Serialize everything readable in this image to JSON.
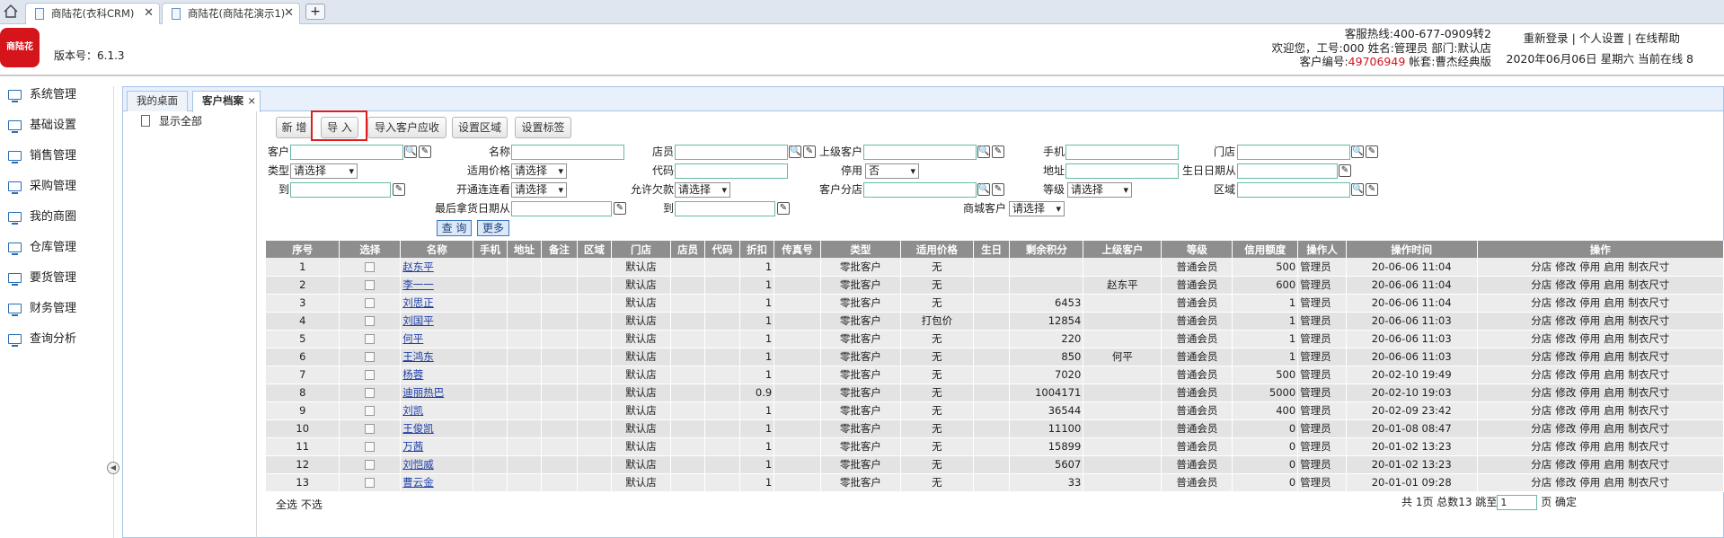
{
  "browser": {
    "tabs": [
      {
        "label": "商陆花(衣科CRM)"
      },
      {
        "label": "商陆花(商陆花演示1)"
      }
    ],
    "new_tab": "+"
  },
  "header": {
    "logo_text": "商陆花",
    "version": "版本号：6.1.3",
    "hotline": "客服热线:400-677-0909转2",
    "welcome": "欢迎您，工号:000 姓名:管理员 部门:默认店",
    "customer_no_label": "客户编号:",
    "customer_no": "49706949",
    "account": "帐套:曹杰经典版",
    "links": "重新登录 | 个人设置 | 在线帮助",
    "date_info": "2020年06月06日 星期六 当前在线 8"
  },
  "sidebar": {
    "items": [
      {
        "label": "系统管理"
      },
      {
        "label": "基础设置"
      },
      {
        "label": "销售管理"
      },
      {
        "label": "采购管理"
      },
      {
        "label": "我的商圈"
      },
      {
        "label": "仓库管理"
      },
      {
        "label": "要货管理"
      },
      {
        "label": "财务管理"
      },
      {
        "label": "查询分析"
      }
    ]
  },
  "main_tabs": [
    {
      "label": "我的桌面"
    },
    {
      "label": "客户档案"
    }
  ],
  "tree": {
    "show_all": "显示全部"
  },
  "toolbar": {
    "new": "新 增",
    "import": "导 入",
    "import_receivable": "导入客户应收",
    "set_region": "设置区域",
    "set_tag": "设置标签"
  },
  "filters": {
    "customer": "客户",
    "name": "名称",
    "clerk": "店员",
    "parent_customer": "上级客户",
    "mobile": "手机",
    "store": "门店",
    "type": "类型",
    "type_value": "请选择",
    "price": "适用价格",
    "price_value": "请选择",
    "code": "代码",
    "disabled": "停用",
    "disabled_value": "否",
    "address": "地址",
    "birthday_from": "生日日期从",
    "to": "到",
    "open_view": "开通连连看",
    "open_view_value": "请选择",
    "allow_debt": "允许欠款",
    "allow_debt_value": "请选择",
    "branch": "客户分店",
    "level": "等级",
    "level_value": "请选择",
    "region": "区域",
    "last_pick_from": "最后拿货日期从",
    "mall_customer": "商城客户",
    "mall_value": "请选择",
    "query": "查 询",
    "more": "更多"
  },
  "table": {
    "columns": [
      "序号",
      "选择",
      "名称",
      "手机",
      "地址",
      "备注",
      "区域",
      "门店",
      "店员",
      "代码",
      "折扣",
      "传真号",
      "类型",
      "适用价格",
      "生日",
      "剩余积分",
      "上级客户",
      "等级",
      "信用额度",
      "操作人",
      "操作时间",
      "操作"
    ],
    "ops": [
      "分店",
      "修改",
      "停用",
      "启用",
      "制衣尺寸"
    ],
    "rows": [
      {
        "no": "1",
        "name": "赵东平",
        "store": "默认店",
        "discount": "1",
        "type": "零批客户",
        "price": "无",
        "points": "",
        "parent": "",
        "level": "普通会员",
        "credit": "500",
        "op": "管理员",
        "time": "20-06-06 11:04"
      },
      {
        "no": "2",
        "name": "李一一",
        "store": "默认店",
        "discount": "1",
        "type": "零批客户",
        "price": "无",
        "points": "",
        "parent": "赵东平",
        "level": "普通会员",
        "credit": "600",
        "op": "管理员",
        "time": "20-06-06 11:04"
      },
      {
        "no": "3",
        "name": "刘思正",
        "store": "默认店",
        "discount": "1",
        "type": "零批客户",
        "price": "无",
        "points": "6453",
        "parent": "",
        "level": "普通会员",
        "credit": "1",
        "op": "管理员",
        "time": "20-06-06 11:04"
      },
      {
        "no": "4",
        "name": "刘国平",
        "store": "默认店",
        "discount": "1",
        "type": "零批客户",
        "price": "打包价",
        "points": "12854",
        "parent": "",
        "level": "普通会员",
        "credit": "1",
        "op": "管理员",
        "time": "20-06-06 11:03"
      },
      {
        "no": "5",
        "name": "何平",
        "store": "默认店",
        "discount": "1",
        "type": "零批客户",
        "price": "无",
        "points": "220",
        "parent": "",
        "level": "普通会员",
        "credit": "1",
        "op": "管理员",
        "time": "20-06-06 11:03"
      },
      {
        "no": "6",
        "name": "王鸿东",
        "store": "默认店",
        "discount": "1",
        "type": "零批客户",
        "price": "无",
        "points": "850",
        "parent": "何平",
        "level": "普通会员",
        "credit": "1",
        "op": "管理员",
        "time": "20-06-06 11:03"
      },
      {
        "no": "7",
        "name": "杨蓉",
        "store": "默认店",
        "discount": "1",
        "type": "零批客户",
        "price": "无",
        "points": "7020",
        "parent": "",
        "level": "普通会员",
        "credit": "500",
        "op": "管理员",
        "time": "20-02-10 19:49"
      },
      {
        "no": "8",
        "name": "迪丽热巴",
        "store": "默认店",
        "discount": "0.9",
        "type": "零批客户",
        "price": "无",
        "points": "1004171",
        "parent": "",
        "level": "普通会员",
        "credit": "5000",
        "op": "管理员",
        "time": "20-02-10 19:03"
      },
      {
        "no": "9",
        "name": "刘凯",
        "store": "默认店",
        "discount": "1",
        "type": "零批客户",
        "price": "无",
        "points": "36544",
        "parent": "",
        "level": "普通会员",
        "credit": "400",
        "op": "管理员",
        "time": "20-02-09 23:42"
      },
      {
        "no": "10",
        "name": "王俊凯",
        "store": "默认店",
        "discount": "1",
        "type": "零批客户",
        "price": "无",
        "points": "11100",
        "parent": "",
        "level": "普通会员",
        "credit": "0",
        "op": "管理员",
        "time": "20-01-08 08:47"
      },
      {
        "no": "11",
        "name": "万茜",
        "store": "默认店",
        "discount": "1",
        "type": "零批客户",
        "price": "无",
        "points": "15899",
        "parent": "",
        "level": "普通会员",
        "credit": "0",
        "op": "管理员",
        "time": "20-01-02 13:23"
      },
      {
        "no": "12",
        "name": "刘恺威",
        "store": "默认店",
        "discount": "1",
        "type": "零批客户",
        "price": "无",
        "points": "5607",
        "parent": "",
        "level": "普通会员",
        "credit": "0",
        "op": "管理员",
        "time": "20-01-02 13:23"
      },
      {
        "no": "13",
        "name": "曹云金",
        "store": "默认店",
        "discount": "1",
        "type": "零批客户",
        "price": "无",
        "points": "33",
        "parent": "",
        "level": "普通会员",
        "credit": "0",
        "op": "管理员",
        "time": "20-01-01 09:28"
      }
    ]
  },
  "footer": {
    "select_all": "全选",
    "select_none": "不选",
    "page_info": "共 1页 总数13 跳至",
    "page_value": "1",
    "page_suffix": "页",
    "confirm": "确定"
  }
}
